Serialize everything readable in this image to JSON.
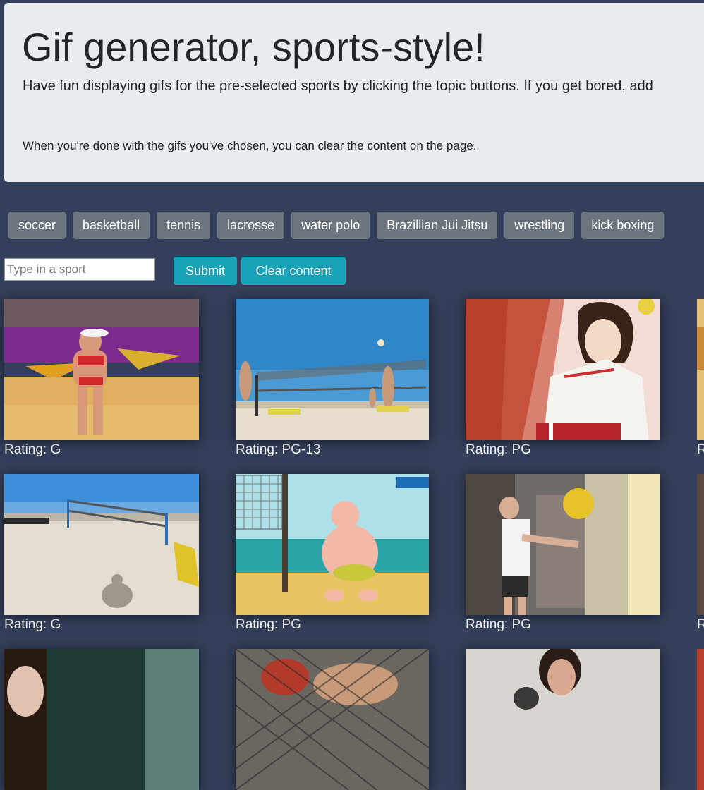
{
  "header": {
    "title": "Gif generator, sports-style!",
    "lead": "Have fun displaying gifs for the pre-selected sports by clicking the topic buttons. If you get bored, add",
    "note": "When you're done with the gifs you've chosen, you can clear the content on the page."
  },
  "topics": [
    {
      "label": "soccer"
    },
    {
      "label": "basketball"
    },
    {
      "label": "tennis"
    },
    {
      "label": "lacrosse"
    },
    {
      "label": "water polo"
    },
    {
      "label": "Brazillian Jui Jitsu"
    },
    {
      "label": "wrestling"
    },
    {
      "label": "kick boxing"
    }
  ],
  "form": {
    "placeholder": "Type in a sport",
    "value": "",
    "submit_label": "Submit",
    "clear_label": "Clear content"
  },
  "gifs": [
    {
      "rating": "Rating: G",
      "scene": "beach-volleyball-player"
    },
    {
      "rating": "Rating: PG-13",
      "scene": "beach-volleyball-net"
    },
    {
      "rating": "Rating: PG",
      "scene": "anime-volleyball"
    },
    {
      "rating": "R",
      "scene": "partial-gif"
    },
    {
      "rating": "Rating: G",
      "scene": "beach-volleyball-court"
    },
    {
      "rating": "Rating: PG",
      "scene": "cartoon-volleyball"
    },
    {
      "rating": "Rating: PG",
      "scene": "bedroom-volleyball"
    },
    {
      "rating": "R",
      "scene": "partial-gif"
    },
    {
      "rating": "",
      "scene": "woman-portrait"
    },
    {
      "rating": "",
      "scene": "cage-fight"
    },
    {
      "rating": "",
      "scene": "boxing-training"
    },
    {
      "rating": "",
      "scene": "partial-gif"
    }
  ],
  "colors": {
    "page_background": "#343f5b",
    "jumbotron": "#e9ecef",
    "topic_button": "#6c757d",
    "action_button": "#17a2b8"
  }
}
